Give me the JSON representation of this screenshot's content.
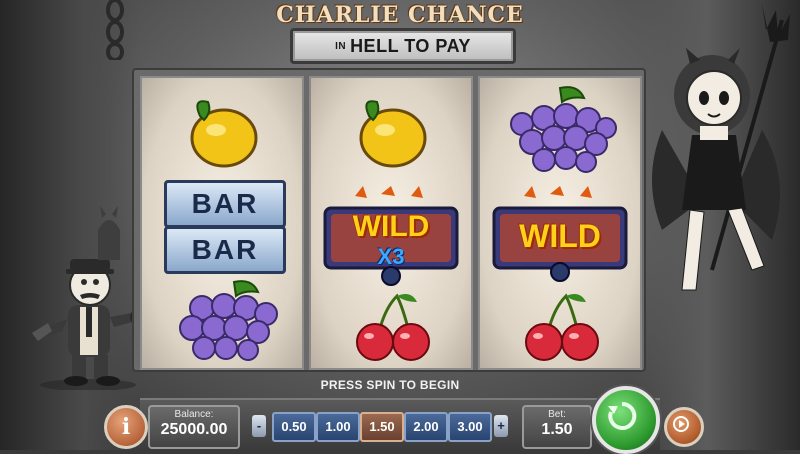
{
  "title": {
    "main": "CHARLIE CHANCE",
    "in_prefix": "IN",
    "sub": "HELL TO PAY"
  },
  "reels": [
    [
      "lemon",
      "bar-double",
      "grapes"
    ],
    [
      "lemon",
      "wild-x3",
      "cherries"
    ],
    [
      "grapes",
      "wild",
      "cherries"
    ]
  ],
  "symbols": {
    "bar_text": "BAR",
    "wild_text": "WILD",
    "multiplier_text": "X3"
  },
  "status": {
    "message": "PRESS SPIN TO BEGIN"
  },
  "balance": {
    "label": "Balance:",
    "value": "25000.00"
  },
  "bet": {
    "label": "Bet:",
    "value": "1.50"
  },
  "coin_values": [
    "0.50",
    "1.00",
    "1.50",
    "2.00",
    "3.00"
  ],
  "selected_coin": "1.50",
  "controls": {
    "info_glyph": "i",
    "minus_glyph": "-",
    "plus_glyph": "+"
  },
  "colors": {
    "spin": "#2e9a2e",
    "info": "#b8643a",
    "coin": "#2a4470",
    "coin_selected": "#6a4030"
  },
  "icons": [
    "info-icon",
    "spin-icon",
    "autoplay-icon",
    "minus-icon",
    "plus-icon"
  ]
}
